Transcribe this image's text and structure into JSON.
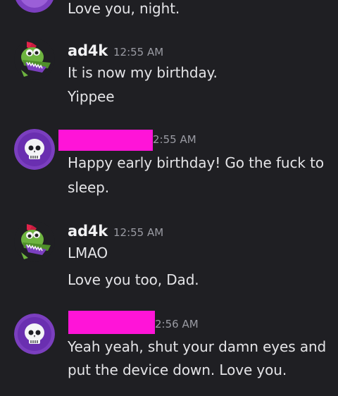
{
  "messages": [
    {
      "id": "prev",
      "username": "",
      "timestamp": "",
      "avatar": "purple-skull-avatar",
      "lines": [
        "Love you, night."
      ]
    },
    {
      "id": "m1",
      "username": "ad4k",
      "timestamp": "12:55 AM",
      "avatar": "green-crocodile-avatar",
      "lines": [
        "It is now my birthday.",
        "Yippee"
      ]
    },
    {
      "id": "m2",
      "username": "",
      "timestamp": "2:55 AM",
      "avatar": "purple-skull-avatar",
      "lines": [
        "Happy early birthday! Go the fuck to",
        "sleep."
      ]
    },
    {
      "id": "m3",
      "username": "ad4k",
      "timestamp": "12:55 AM",
      "avatar": "green-crocodile-avatar",
      "lines": [
        "LMAO",
        "Love you too, Dad."
      ]
    },
    {
      "id": "m4",
      "username": "",
      "timestamp": "2:56 AM",
      "avatar": "purple-skull-avatar",
      "lines": [
        "Yeah yeah, shut your damn eyes and",
        "put the device down. Love you."
      ]
    }
  ],
  "colors": {
    "background": "#1f1f23",
    "redaction": "#ff14d8",
    "avatar_purple": "#7b3fbf"
  }
}
